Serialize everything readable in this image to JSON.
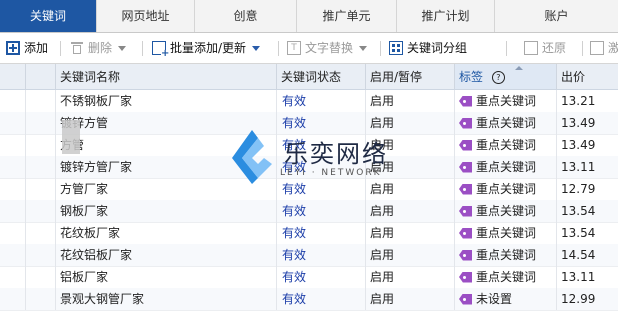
{
  "tabs": [
    {
      "label": "关键词",
      "active": true
    },
    {
      "label": "网页地址",
      "active": false
    },
    {
      "label": "创意",
      "active": false
    },
    {
      "label": "推广单元",
      "active": false
    },
    {
      "label": "推广计划",
      "active": false
    },
    {
      "label": "账户",
      "active": false
    }
  ],
  "toolbar": {
    "add": "添加",
    "delete": "删除",
    "batch_add": "批量添加/更新",
    "text_replace": "文字替换",
    "keyword_group": "关键词分组",
    "restore": "还原",
    "activate": "激"
  },
  "table": {
    "columns": {
      "name": "关键词名称",
      "status": "关键词状态",
      "enable": "启用/暂停",
      "tag": "标签",
      "price": "出价"
    },
    "help_glyph": "?",
    "rows": [
      {
        "name": "不锈钢板厂家",
        "status": "有效",
        "enable": "启用",
        "tag": "重点关键词",
        "price": "13.21"
      },
      {
        "name": "镀锌方管",
        "status": "有效",
        "enable": "启用",
        "tag": "重点关键词",
        "price": "13.49"
      },
      {
        "name": "方管",
        "status": "有效",
        "enable": "启用",
        "tag": "重点关键词",
        "price": "13.49"
      },
      {
        "name": "镀锌方管厂家",
        "status": "有效",
        "enable": "启用",
        "tag": "重点关键词",
        "price": "13.11"
      },
      {
        "name": "方管厂家",
        "status": "有效",
        "enable": "启用",
        "tag": "重点关键词",
        "price": "12.79"
      },
      {
        "name": "钢板厂家",
        "status": "有效",
        "enable": "启用",
        "tag": "重点关键词",
        "price": "13.54"
      },
      {
        "name": "花纹板厂家",
        "status": "有效",
        "enable": "启用",
        "tag": "重点关键词",
        "price": "13.54"
      },
      {
        "name": "花纹铝板厂家",
        "status": "有效",
        "enable": "启用",
        "tag": "重点关键词",
        "price": "14.54"
      },
      {
        "name": "铝板厂家",
        "status": "有效",
        "enable": "启用",
        "tag": "重点关键词",
        "price": "13.11"
      },
      {
        "name": "景观大钢管厂家",
        "status": "有效",
        "enable": "启用",
        "tag": "未设置",
        "price": "12.99"
      }
    ]
  },
  "watermark": {
    "text": "乐奕网络",
    "sub": "LEYI · NETWORK"
  },
  "colors": {
    "accent": "#1e57a3",
    "status": "#1a3ca8",
    "tag": "#9b4fc4"
  }
}
